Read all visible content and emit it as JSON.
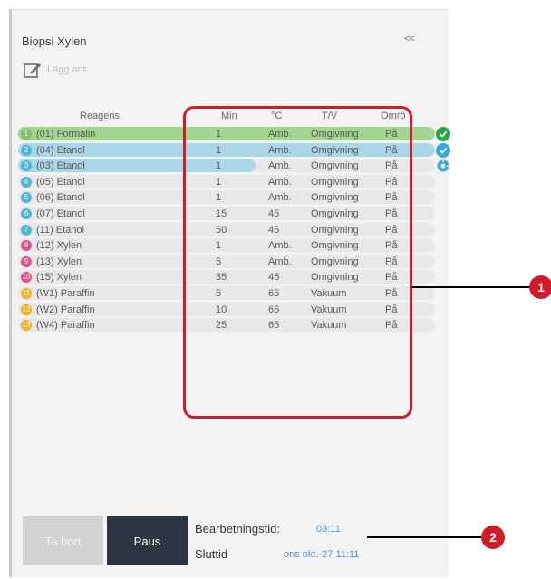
{
  "header": {
    "title": "Biopsi Xylen",
    "collapse_label": "<<"
  },
  "note_button": {
    "label": "Lägg ant."
  },
  "table": {
    "columns": {
      "reagent": "Reagens",
      "min": "Min",
      "temp": "°C",
      "pv": "T/V",
      "stir": "Omrö"
    },
    "rows": [
      {
        "num": "1",
        "name": "(01) Formalin",
        "min": "1",
        "temp": "Amb.",
        "pv": "Omgivning",
        "stir": "På",
        "badge_color": "#7cc36b",
        "fill": 1.0,
        "fill_color": "#a2d58f",
        "status": "complete"
      },
      {
        "num": "2",
        "name": "(04) Etanol",
        "min": "1",
        "temp": "Amb.",
        "pv": "Omgivning",
        "stir": "På",
        "badge_color": "#4db6d8",
        "fill": 1.0,
        "fill_color": "#a9d7e7",
        "status": "complete"
      },
      {
        "num": "3",
        "name": "(03) Etanol",
        "min": "1",
        "temp": "Amb.",
        "pv": "Omgivning",
        "stir": "På",
        "badge_color": "#4db6d8",
        "fill": 0.57,
        "fill_color": "#a9d7e7",
        "status": "running"
      },
      {
        "num": "4",
        "name": "(05) Etanol",
        "min": "1",
        "temp": "Amb.",
        "pv": "Omgivning",
        "stir": "På",
        "badge_color": "#4db6d8",
        "fill": 0,
        "fill_color": "#a9d7e7",
        "status": "pending"
      },
      {
        "num": "5",
        "name": "(06) Etanol",
        "min": "1",
        "temp": "Amb.",
        "pv": "Omgivning",
        "stir": "På",
        "badge_color": "#4db6d8",
        "fill": 0,
        "fill_color": "#a9d7e7",
        "status": "pending"
      },
      {
        "num": "6",
        "name": "(07) Etanol",
        "min": "15",
        "temp": "45",
        "pv": "Omgivning",
        "stir": "På",
        "badge_color": "#4db6d8",
        "fill": 0,
        "fill_color": "#a9d7e7",
        "status": "pending"
      },
      {
        "num": "7",
        "name": "(11) Etanol",
        "min": "50",
        "temp": "45",
        "pv": "Omgivning",
        "stir": "På",
        "badge_color": "#4db6d8",
        "fill": 0,
        "fill_color": "#a9d7e7",
        "status": "pending"
      },
      {
        "num": "8",
        "name": "(12) Xylen",
        "min": "1",
        "temp": "Amb.",
        "pv": "Omgivning",
        "stir": "På",
        "badge_color": "#e0508f",
        "fill": 0,
        "fill_color": "#f0a9c8",
        "status": "pending"
      },
      {
        "num": "9",
        "name": "(13) Xylen",
        "min": "5",
        "temp": "Amb.",
        "pv": "Omgivning",
        "stir": "På",
        "badge_color": "#e0508f",
        "fill": 0,
        "fill_color": "#f0a9c8",
        "status": "pending"
      },
      {
        "num": "10",
        "name": "(15) Xylen",
        "min": "35",
        "temp": "45",
        "pv": "Omgivning",
        "stir": "På",
        "badge_color": "#e0508f",
        "fill": 0,
        "fill_color": "#f0a9c8",
        "status": "pending"
      },
      {
        "num": "11",
        "name": "(W1) Paraffin",
        "min": "5",
        "temp": "65",
        "pv": "Vakuum",
        "stir": "På",
        "badge_color": "#f2b01e",
        "fill": 0,
        "fill_color": "#f7d88e",
        "status": "pending"
      },
      {
        "num": "12",
        "name": "(W2) Paraffin",
        "min": "10",
        "temp": "65",
        "pv": "Vakuum",
        "stir": "På",
        "badge_color": "#f2b01e",
        "fill": 0,
        "fill_color": "#f7d88e",
        "status": "pending"
      },
      {
        "num": "13",
        "name": "(W4) Paraffin",
        "min": "25",
        "temp": "65",
        "pv": "Vakuum",
        "stir": "På",
        "badge_color": "#f2b01e",
        "fill": 0,
        "fill_color": "#f7d88e",
        "status": "pending"
      }
    ]
  },
  "footer": {
    "delete_label": "Ta bort",
    "pause_label": "Paus",
    "processing_time_label": "Bearbetningstid:",
    "processing_time_value": "03:11",
    "end_time_label": "Sluttid",
    "end_time_value": "ons okt.-27 11:11"
  },
  "callouts": {
    "one": "1",
    "two": "2"
  },
  "colors": {
    "highlight": "#d11a2a",
    "status_complete": "#27a844",
    "status_done_blue": "#3aa7e0",
    "status_running": "#3aa7e0",
    "value_blue": "#4f97d6"
  }
}
